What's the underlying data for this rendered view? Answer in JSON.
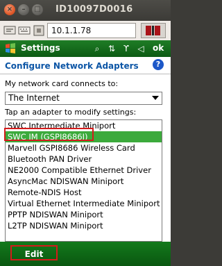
{
  "window": {
    "title": "ID10097D0016"
  },
  "toolbar": {
    "ip_address": "10.1.1.78"
  },
  "titlebar": {
    "app_name": "Settings",
    "ok_label": "ok"
  },
  "page": {
    "header": "Configure Network Adapters",
    "help_label": "?",
    "connects_to_label": "My network card connects to:",
    "connects_to_value": "The Internet",
    "list_label": "Tap an adapter to modify settings:",
    "adapters": [
      "SWC Intermediate Miniport",
      "SWC IM (GSPI8686I)",
      "Marvell GSPI8686 Wireless Card",
      "Bluetooth PAN Driver",
      "NE2000 Compatible Ethernet Driver",
      "AsyncMac NDISWAN Miniport",
      "Remote-NDIS Host",
      "Virtual Ethernet Intermediate Miniport",
      "PPTP NDISWAN Miniport",
      "L2TP NDISWAN Miniport"
    ],
    "selected_index": 1
  },
  "softkeys": {
    "left": "Edit"
  },
  "colors": {
    "accent_green": "#0c5a13",
    "selection": "#3caa3c",
    "header_blue": "#0d56a6",
    "highlight_red": "#d41b1b"
  }
}
